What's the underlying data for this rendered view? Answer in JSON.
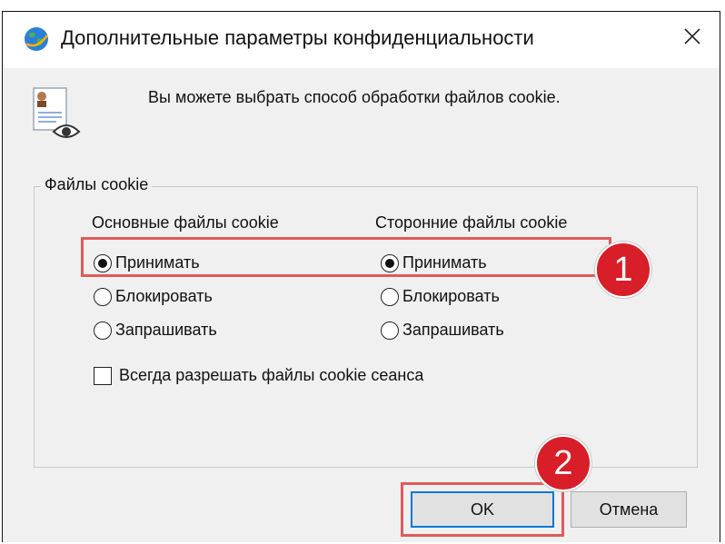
{
  "window": {
    "title": "Дополнительные параметры конфиденциальности",
    "close_glyph": "✕",
    "icons": {
      "app": "globe-icon",
      "header": "privacy-document-eye-icon",
      "close": "close-icon"
    }
  },
  "intro_text": "Вы можете выбрать способ обработки файлов cookie.",
  "cookies_group": {
    "legend": "Файлы cookie",
    "first_party": {
      "header": "Основные файлы cookie",
      "selected": "accept",
      "options": {
        "accept": "Принимать",
        "block": "Блокировать",
        "prompt": "Запрашивать"
      }
    },
    "third_party": {
      "header": "Сторонние файлы cookie",
      "selected": "accept",
      "options": {
        "accept": "Принимать",
        "block": "Блокировать",
        "prompt": "Запрашивать"
      }
    },
    "session_cookies": {
      "label": "Всегда разрешать файлы cookie сеанса",
      "checked": false
    }
  },
  "buttons": {
    "ok": "OK",
    "cancel": "Отмена"
  },
  "annotations": {
    "step1": "1",
    "step2": "2",
    "color": "#d81e28",
    "outline_color": "#e05a5a"
  }
}
